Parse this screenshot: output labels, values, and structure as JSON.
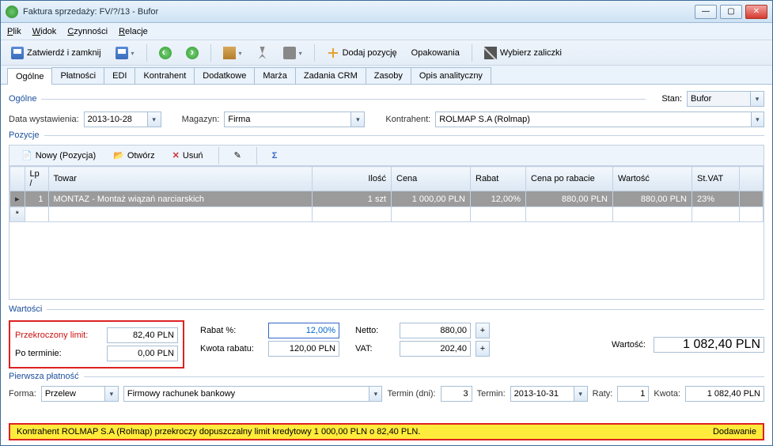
{
  "window": {
    "title": "Faktura sprzedaży: FV/?/13 - Bufor"
  },
  "menu": {
    "plik": "Plik",
    "widok": "Widok",
    "czynnosci": "Czynności",
    "relacje": "Relacje"
  },
  "toolbar": {
    "zatwierdz": "Zatwierdź i zamknij",
    "dodaj_pozycje": "Dodaj pozycję",
    "opakowania": "Opakowania",
    "wybierz_zaliczki": "Wybierz zaliczki"
  },
  "tabs": [
    "Ogólne",
    "Płatności",
    "EDI",
    "Kontrahent",
    "Dodatkowe",
    "Marża",
    "Zadania CRM",
    "Zasoby",
    "Opis analityczny"
  ],
  "section": {
    "ogolne": "Ogólne",
    "pozycje": "Pozycje",
    "wartosci": "Wartości",
    "pierwsza": "Pierwsza płatność"
  },
  "stan": {
    "label": "Stan:",
    "value": "Bufor"
  },
  "header": {
    "data_label": "Data wystawienia:",
    "data_value": "2013-10-28",
    "magazyn_label": "Magazyn:",
    "magazyn_value": "Firma",
    "kontrahent_label": "Kontrahent:",
    "kontrahent_value": "ROLMAP S.A (Rolmap)"
  },
  "gridtb": {
    "nowy": "Nowy (Pozycja)",
    "otworz": "Otwórz",
    "usun": "Usuń"
  },
  "gridcols": {
    "lp": "Lp",
    "towar": "Towar",
    "ilosc": "Ilość",
    "cena": "Cena",
    "rabat": "Rabat",
    "cpr": "Cena po rabacie",
    "wartosc": "Wartość",
    "stvat": "St.VAT"
  },
  "gridrow": {
    "lp": "1",
    "towar": "MONTAZ - Montaż wiązań narciarskich",
    "ilosc": "1 szt",
    "cena": "1 000,00 PLN",
    "rabat": "12,00%",
    "cpr": "880,00 PLN",
    "wartosc": "880,00 PLN",
    "stvat": "23%"
  },
  "limits": {
    "przekroczony_label": "Przekroczony limit:",
    "przekroczony_value": "82,40 PLN",
    "poterminie_label": "Po terminie:",
    "poterminie_value": "0,00 PLN"
  },
  "rabat": {
    "rabatpct_label": "Rabat %:",
    "rabatpct_value": "12,00%",
    "kwota_label": "Kwota rabatu:",
    "kwota_value": "120,00 PLN"
  },
  "sums": {
    "netto_label": "Netto:",
    "netto_value": "880,00",
    "vat_label": "VAT:",
    "vat_value": "202,40",
    "wartosc_label": "Wartość:",
    "wartosc_value": "1 082,40 PLN"
  },
  "payment": {
    "forma_label": "Forma:",
    "forma_value": "Przelew",
    "rachunek": "Firmowy rachunek bankowy",
    "termin_dni_label": "Termin (dni):",
    "termin_dni_value": "3",
    "termin_label": "Termin:",
    "termin_value": "2013-10-31",
    "raty_label": "Raty:",
    "raty_value": "1",
    "kwota_label": "Kwota:",
    "kwota_value": "1 082,40 PLN"
  },
  "status": {
    "msg": "Kontrahent ROLMAP S.A (Rolmap) przekroczy dopuszczalny limit kredytowy 1 000,00 PLN o 82,40 PLN.",
    "mode": "Dodawanie"
  }
}
